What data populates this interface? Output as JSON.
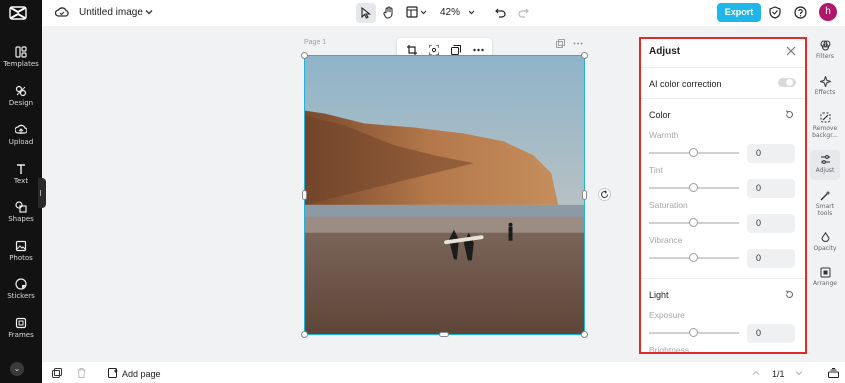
{
  "app": {
    "logo": "capcut-logo"
  },
  "left_nav": [
    {
      "label": "Templates",
      "icon": "templates-icon"
    },
    {
      "label": "Design",
      "icon": "design-icon"
    },
    {
      "label": "Upload",
      "icon": "upload-icon"
    },
    {
      "label": "Text",
      "icon": "text-icon"
    },
    {
      "label": "Shapes",
      "icon": "shapes-icon"
    },
    {
      "label": "Photos",
      "icon": "photos-icon"
    },
    {
      "label": "Stickers",
      "icon": "stickers-icon"
    },
    {
      "label": "Frames",
      "icon": "frames-icon"
    }
  ],
  "topbar": {
    "title": "Untitled image",
    "zoom": "42%",
    "export_label": "Export",
    "avatar_letter": "h",
    "accent": "#1fb6ea"
  },
  "canvas": {
    "page_label": "Page 1"
  },
  "adjust_panel": {
    "title": "Adjust",
    "ai_label": "AI color correction",
    "ai_enabled": false,
    "border_color": "#e12b2b",
    "color_section": {
      "title": "Color",
      "sliders": [
        {
          "label": "Warmth",
          "value": "0"
        },
        {
          "label": "Tint",
          "value": "0"
        },
        {
          "label": "Saturation",
          "value": "0"
        },
        {
          "label": "Vibrance",
          "value": "0"
        }
      ]
    },
    "light_section": {
      "title": "Light",
      "sliders": [
        {
          "label": "Exposure",
          "value": "0"
        },
        {
          "label": "Brightness",
          "value": ""
        }
      ]
    }
  },
  "right_rail": [
    {
      "label": "Filters",
      "icon": "filters-icon"
    },
    {
      "label": "Effects",
      "icon": "effects-icon"
    },
    {
      "label": "Remove backgr...",
      "icon": "remove-background-icon"
    },
    {
      "label": "Adjust",
      "icon": "adjust-icon",
      "active": true
    },
    {
      "label": "Smart tools",
      "icon": "smart-tools-icon"
    },
    {
      "label": "Opacity",
      "icon": "opacity-icon"
    },
    {
      "label": "Arrange",
      "icon": "arrange-icon"
    }
  ],
  "bottombar": {
    "add_page_label": "Add page",
    "pagination": "1/1"
  }
}
